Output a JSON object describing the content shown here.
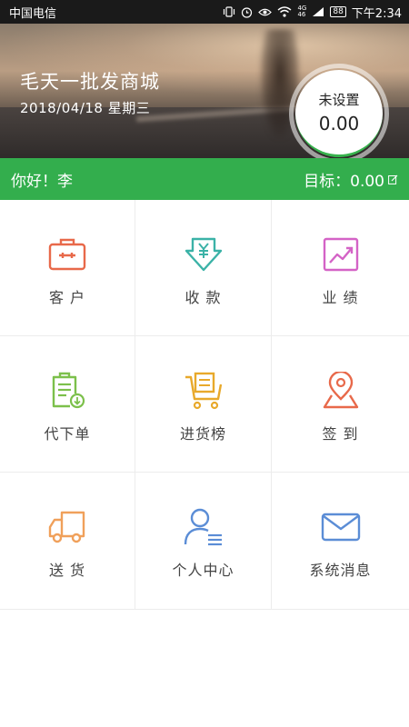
{
  "status_bar": {
    "carrier": "中国电信",
    "battery": "88",
    "signal_text": [
      "4G",
      "46"
    ],
    "time": "下午2:34"
  },
  "header": {
    "store_name": "毛天一批发商城",
    "date": "2018/04/18 星期三"
  },
  "goal_widget": {
    "label": "未设置",
    "value": "0.00"
  },
  "greeting_bar": {
    "greeting": "你好！李",
    "target_label": "目标：0.00"
  },
  "menu": [
    {
      "label": "客 户",
      "icon": "briefcase-icon",
      "color": "#e8694a"
    },
    {
      "label": "收 款",
      "icon": "yen-arrow-icon",
      "color": "#3bb2a7"
    },
    {
      "label": "业 绩",
      "icon": "trend-chart-icon",
      "color": "#d463c6"
    },
    {
      "label": "代下单",
      "icon": "order-clipboard-icon",
      "color": "#7cc04b"
    },
    {
      "label": "进货榜",
      "icon": "shopping-cart-icon",
      "color": "#e8a92b"
    },
    {
      "label": "签 到",
      "icon": "location-pin-icon",
      "color": "#e8694a"
    },
    {
      "label": "送 货",
      "icon": "truck-icon",
      "color": "#f0a05a"
    },
    {
      "label": "个人中心",
      "icon": "user-profile-icon",
      "color": "#5b8dd6"
    },
    {
      "label": "系统消息",
      "icon": "envelope-icon",
      "color": "#5b8dd6"
    }
  ],
  "colors": {
    "accent_green": "#33ae4d",
    "status_bar": "#1a1a1a"
  }
}
